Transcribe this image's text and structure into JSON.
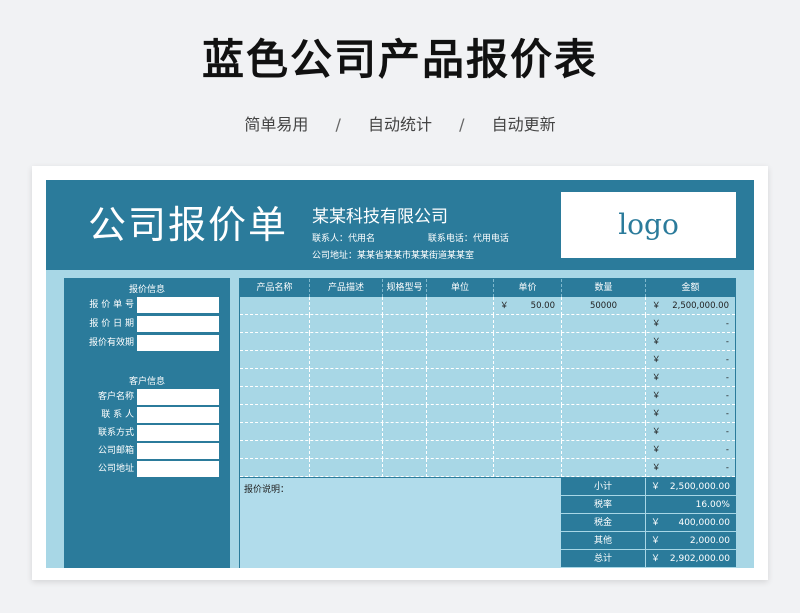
{
  "page": {
    "title": "蓝色公司产品报价表",
    "features": [
      "简单易用",
      "自动统计",
      "自动更新"
    ],
    "separator": "/"
  },
  "header": {
    "big_title": "公司报价单",
    "company": "某某科技有限公司",
    "contact_person": "联系人：代用名",
    "contact_phone": "联系电话：代用电话",
    "address": "公司地址：某某省某某市某某街道某某室",
    "logo": "logo"
  },
  "quote_info": {
    "section": "报价信息",
    "fields": [
      {
        "label": "报 价 单 号",
        "value": ""
      },
      {
        "label": "报 价 日 期",
        "value": ""
      },
      {
        "label": "报价有效期",
        "value": ""
      }
    ]
  },
  "customer_info": {
    "section": "客户信息",
    "fields": [
      {
        "label": "客户名称",
        "value": ""
      },
      {
        "label": "联 系 人",
        "value": ""
      },
      {
        "label": "联系方式",
        "value": ""
      },
      {
        "label": "公司邮箱",
        "value": ""
      },
      {
        "label": "公司地址",
        "value": ""
      }
    ]
  },
  "table": {
    "columns": [
      "产品名称",
      "产品描述",
      "规格型号",
      "单位",
      "单价",
      "数量",
      "金额"
    ],
    "currency_symbol": "￥",
    "rows": [
      {
        "name": "",
        "desc": "",
        "spec": "",
        "unit": "",
        "price": "50.00",
        "qty": "50000",
        "amount": "2,500,000.00"
      },
      {
        "name": "",
        "desc": "",
        "spec": "",
        "unit": "",
        "price": "",
        "qty": "",
        "amount": "-"
      },
      {
        "name": "",
        "desc": "",
        "spec": "",
        "unit": "",
        "price": "",
        "qty": "",
        "amount": "-"
      },
      {
        "name": "",
        "desc": "",
        "spec": "",
        "unit": "",
        "price": "",
        "qty": "",
        "amount": "-"
      },
      {
        "name": "",
        "desc": "",
        "spec": "",
        "unit": "",
        "price": "",
        "qty": "",
        "amount": "-"
      },
      {
        "name": "",
        "desc": "",
        "spec": "",
        "unit": "",
        "price": "",
        "qty": "",
        "amount": "-"
      },
      {
        "name": "",
        "desc": "",
        "spec": "",
        "unit": "",
        "price": "",
        "qty": "",
        "amount": "-"
      },
      {
        "name": "",
        "desc": "",
        "spec": "",
        "unit": "",
        "price": "",
        "qty": "",
        "amount": "-"
      },
      {
        "name": "",
        "desc": "",
        "spec": "",
        "unit": "",
        "price": "",
        "qty": "",
        "amount": "-"
      },
      {
        "name": "",
        "desc": "",
        "spec": "",
        "unit": "",
        "price": "",
        "qty": "",
        "amount": "-"
      }
    ]
  },
  "memo": {
    "label": "报价说明："
  },
  "totals": [
    {
      "label": "小计",
      "yen": "￥",
      "value": "2,500,000.00"
    },
    {
      "label": "税率",
      "yen": "",
      "value": "16.00%"
    },
    {
      "label": "税金",
      "yen": "￥",
      "value": "400,000.00"
    },
    {
      "label": "其他",
      "yen": "￥",
      "value": "2,000.00"
    },
    {
      "label": "总计",
      "yen": "￥",
      "value": "2,902,000.00"
    }
  ],
  "colors": {
    "primary": "#2b7b9b",
    "light": "#a8d7e6",
    "background": "#f1f2f4"
  }
}
